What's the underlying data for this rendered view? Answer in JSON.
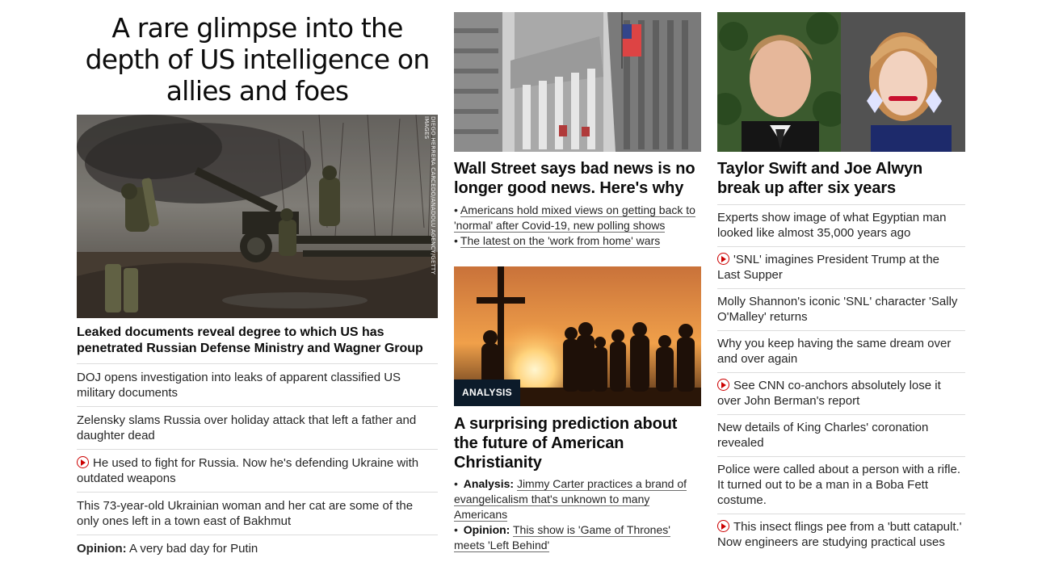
{
  "left": {
    "hero_headline": "A rare glimpse into the depth of US intelligence on allies and foes",
    "image_credit": "DIEGO HERRERA CARCEDO/ANADOLU AGENCY/GETTY IMAGES",
    "lead_title": "Leaked documents reveal degree to which US has penetrated Russian Defense Ministry and Wagner Group",
    "items": [
      {
        "text": "DOJ opens investigation into leaks of apparent classified US military documents",
        "video": false
      },
      {
        "text": "Zelensky slams Russia over holiday attack that left a father and daughter dead",
        "video": false
      },
      {
        "text": "He used to fight for Russia. Now he's defending Ukraine with outdated weapons",
        "video": true
      },
      {
        "text": "This 73-year-old Ukrainian woman and her cat are some of the only ones left in a town east of Bakhmut",
        "video": false
      }
    ],
    "opinion_label": "Opinion:",
    "opinion_text": " A very bad day for Putin"
  },
  "middle": {
    "story1_title": "Wall Street says bad news is no longer good news. Here's why",
    "story1_bullets": [
      "Americans hold mixed views on getting back to 'normal' after Covid-19, new polling shows",
      "The latest on the 'work from home' wars"
    ],
    "analysis_badge": "ANALYSIS",
    "story2_title": "A surprising prediction about the future of American Christianity",
    "story2_bullet1_label": "Analysis:",
    "story2_bullet1_text": "Jimmy Carter practices a brand of evangelicalism that's unknown to many Americans",
    "story2_bullet2_label": "Opinion:",
    "story2_bullet2_text": "This show is 'Game of Thrones' meets 'Left Behind'"
  },
  "right": {
    "story_title": "Taylor Swift and Joe Alwyn break up after six years",
    "items": [
      {
        "text": "Experts show image of what Egyptian man looked like almost 35,000 years ago",
        "video": false
      },
      {
        "text": "'SNL' imagines President Trump at the Last Supper",
        "video": true
      },
      {
        "text": "Molly Shannon's iconic 'SNL' character 'Sally O'Malley' returns",
        "video": false
      },
      {
        "text": "Why you keep having the same dream over and over again",
        "video": false
      },
      {
        "text": "See CNN co-anchors absolutely lose it over John Berman's report",
        "video": true
      },
      {
        "text": "New details of King Charles' coronation revealed",
        "video": false
      },
      {
        "text": "Police were called about a person with a rifle. It turned out to be a man in a Boba Fett costume.",
        "video": false
      },
      {
        "text": "This insect flings pee from a 'butt catapult.' Now engineers are studying practical uses",
        "video": true
      }
    ]
  },
  "colors": {
    "video_icon": "#cc0000",
    "badge_bg": "#0c1b2a",
    "divider": "#dcdcdc"
  },
  "icons": {
    "video": "play-circle-icon"
  }
}
